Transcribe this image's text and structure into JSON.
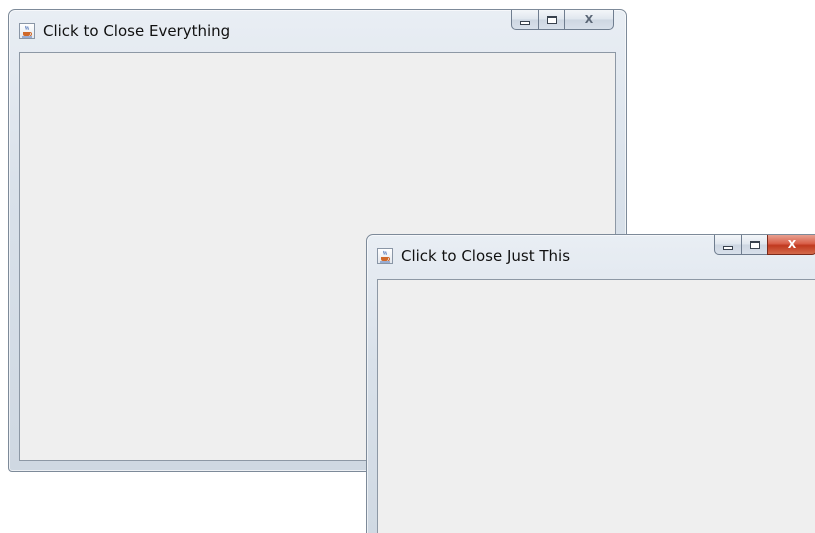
{
  "windows": {
    "back": {
      "title": "Click to Close Everything",
      "icon": "java-cup-icon",
      "close_glyph": "X"
    },
    "front": {
      "title": "Click to Close Just This",
      "icon": "java-cup-icon",
      "close_glyph": "X",
      "close_color": "#c83a22"
    }
  },
  "colors": {
    "client_background": "#efefef",
    "frame": "#d9e1ea"
  }
}
